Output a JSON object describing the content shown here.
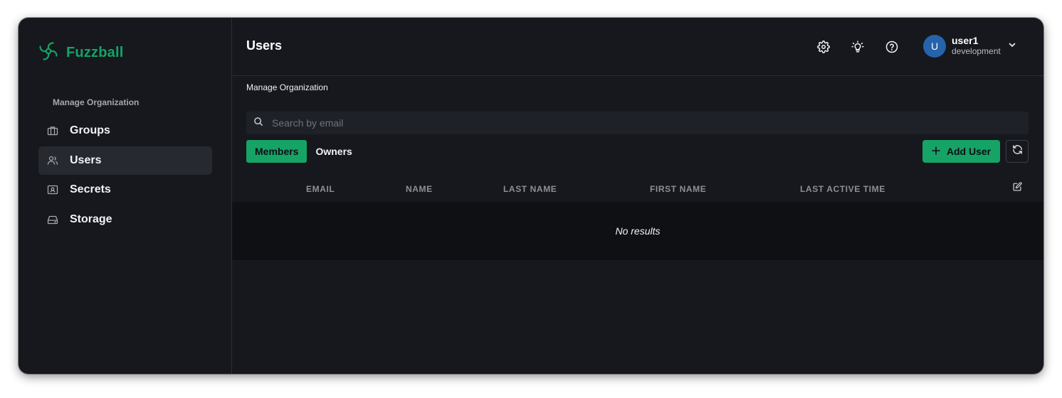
{
  "app": {
    "name": "Fuzzball",
    "brand_color": "#16a366"
  },
  "sidebar": {
    "section_label": "Manage Organization",
    "items": [
      {
        "label": "Groups",
        "icon": "briefcase-icon",
        "active": false
      },
      {
        "label": "Users",
        "icon": "users-icon",
        "active": true
      },
      {
        "label": "Secrets",
        "icon": "secret-card-icon",
        "active": false
      },
      {
        "label": "Storage",
        "icon": "storage-drive-icon",
        "active": false
      }
    ]
  },
  "header": {
    "title": "Users",
    "icons": [
      "settings-icon",
      "lightbulb-icon",
      "help-icon",
      "chevron-down-icon"
    ],
    "user": {
      "avatar_letter": "U",
      "name": "user1",
      "organization": "development"
    }
  },
  "main": {
    "breadcrumb": "Manage Organization",
    "search": {
      "placeholder": "Search by email",
      "value": ""
    },
    "tabs": [
      {
        "label": "Members",
        "active": true
      },
      {
        "label": "Owners",
        "active": false
      }
    ],
    "add_button": "Add User",
    "table": {
      "columns": [
        "EMAIL",
        "NAME",
        "LAST NAME",
        "FIRST NAME",
        "LAST ACTIVE TIME"
      ],
      "rows": [],
      "empty_message": "No results"
    }
  }
}
